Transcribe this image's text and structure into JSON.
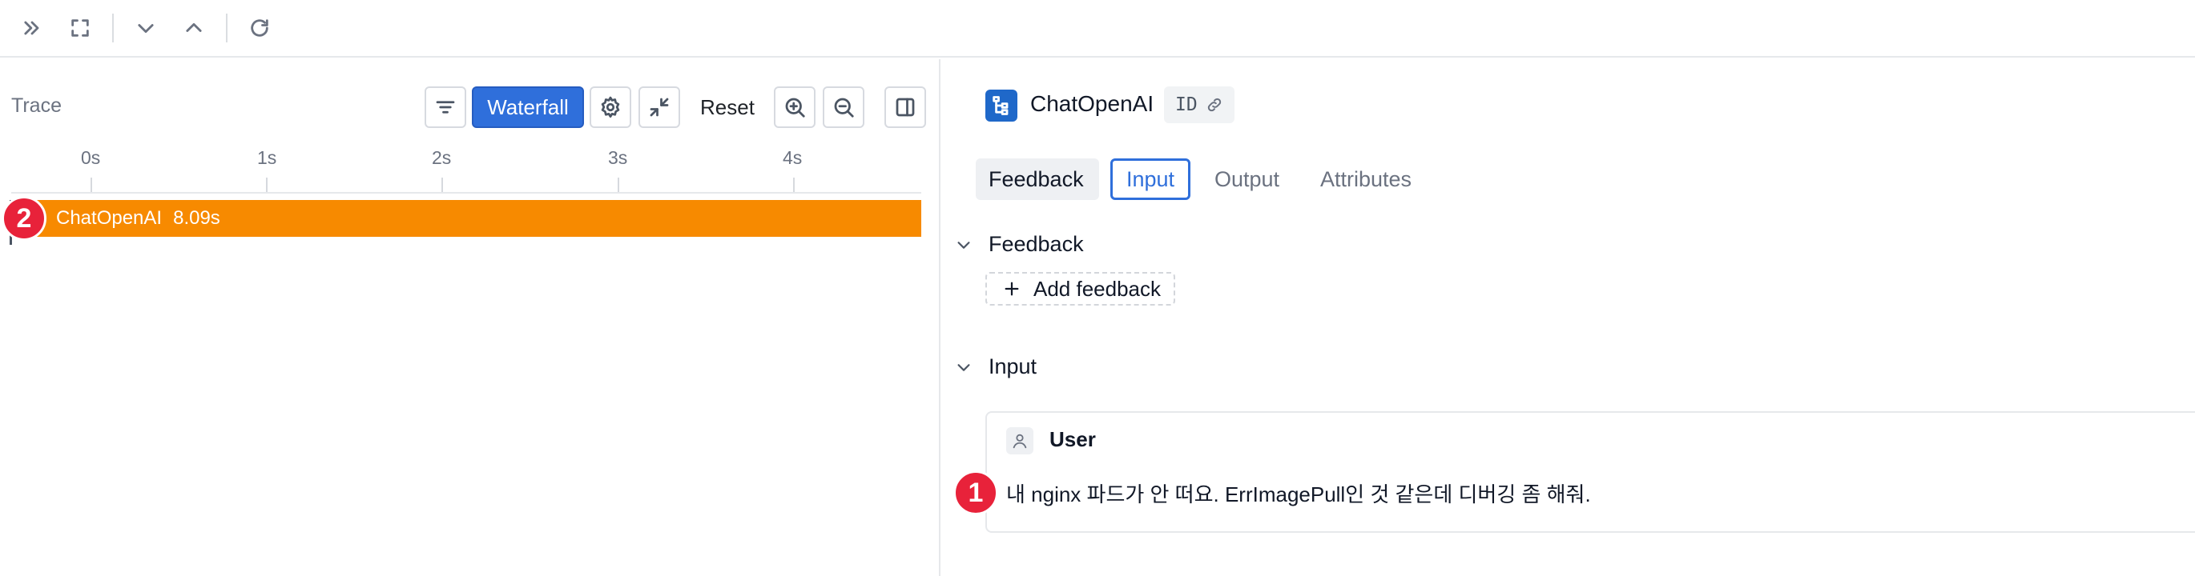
{
  "toolbar": {
    "icons": [
      "expand-right-icon",
      "fullscreen-icon",
      "chevron-down-icon",
      "chevron-up-icon",
      "refresh-icon"
    ]
  },
  "trace_panel": {
    "title": "Trace",
    "view_mode_label": "Waterfall",
    "reset_label": "Reset",
    "axis_ticks": [
      "0s",
      "1s",
      "2s",
      "3s",
      "4s"
    ],
    "span": {
      "name": "ChatOpenAI",
      "duration": "8.09s",
      "color": "#f78a00"
    },
    "badge": "2"
  },
  "detail_panel": {
    "title": "ChatOpenAI",
    "id_label": "ID",
    "tabs": [
      "Feedback",
      "Input",
      "Output",
      "Attributes"
    ],
    "active_tab": "Input",
    "feedback_section": {
      "title": "Feedback",
      "add_label": "Add feedback"
    },
    "input_section": {
      "title": "Input",
      "message": {
        "role": "User",
        "text": "내 nginx 파드가 안 떠요. ErrImagePull인 것 같은데 디버깅 좀 해줘."
      },
      "badge": "1"
    }
  },
  "colors": {
    "accent": "#2f6fdb",
    "span_bar": "#f78a00",
    "badge": "#e8223a"
  }
}
